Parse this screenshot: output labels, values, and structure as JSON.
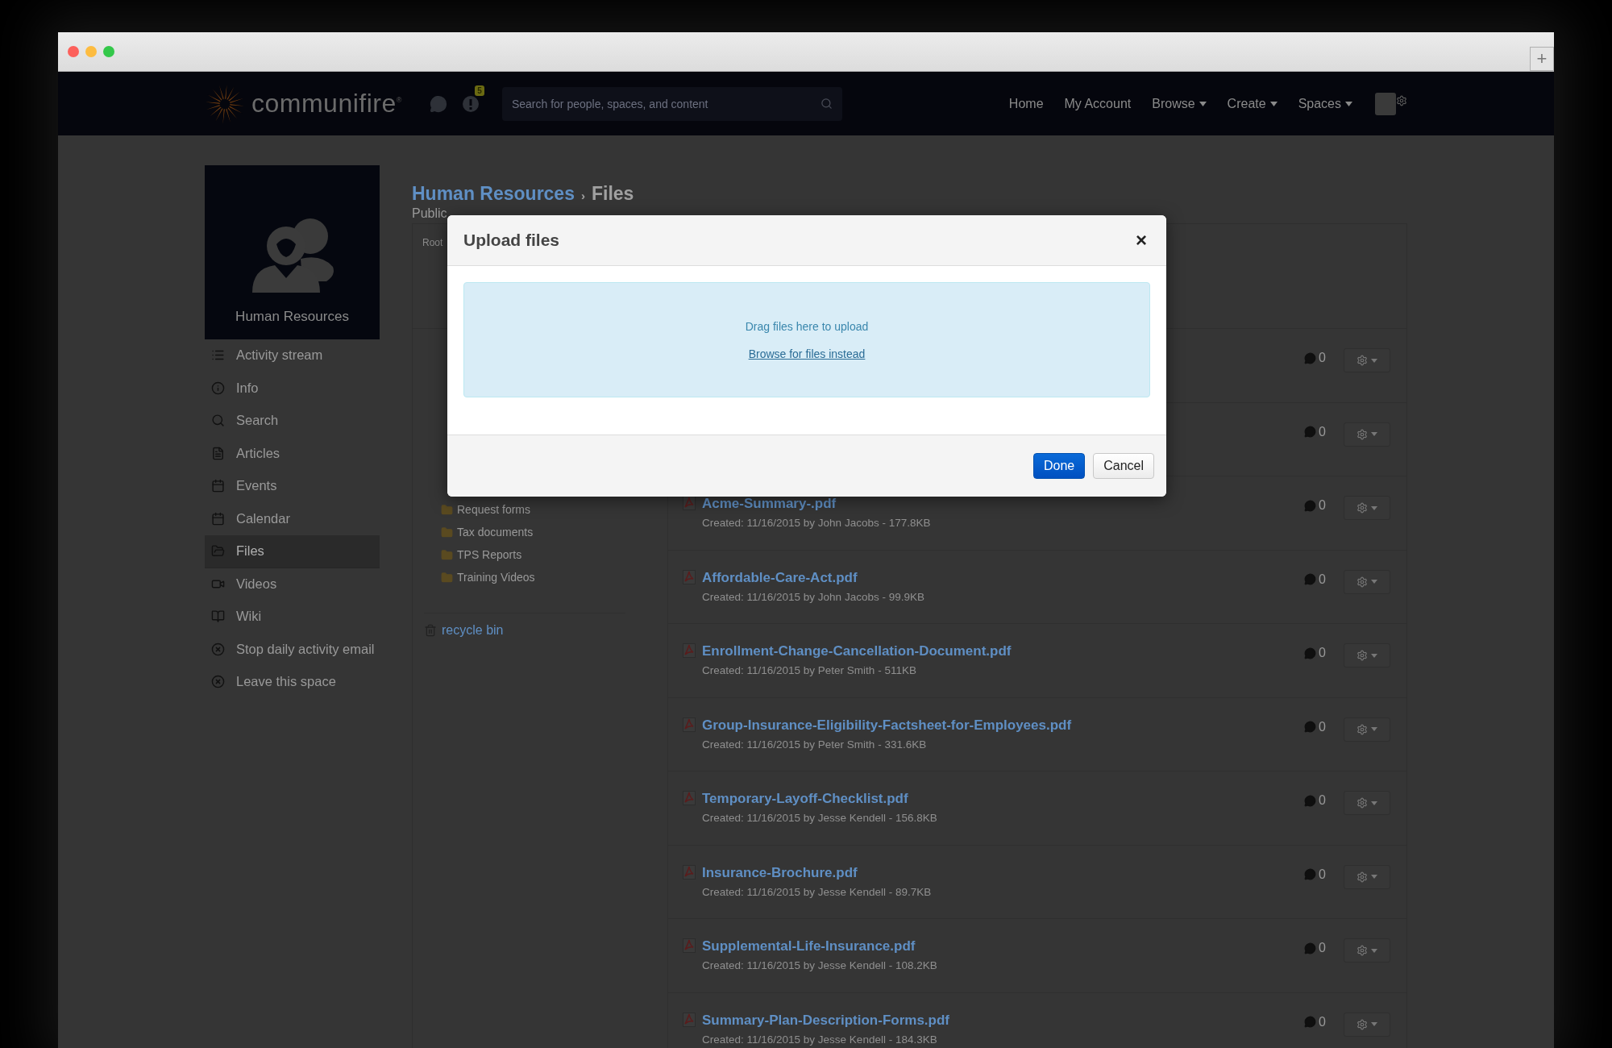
{
  "window": {
    "traffic_lights": [
      {
        "color": "#fc605b"
      },
      {
        "color": "#fdbc40"
      },
      {
        "color": "#34c84a"
      }
    ],
    "new_tab": "+"
  },
  "navbar": {
    "logo": "communifire",
    "logo_mark": "®",
    "notification_count": "5",
    "search": {
      "placeholder": "Search for people, spaces, and content"
    },
    "links": [
      {
        "label": "Home",
        "dropdown": false
      },
      {
        "label": "My Account",
        "dropdown": false
      },
      {
        "label": "Browse",
        "dropdown": true
      },
      {
        "label": "Create",
        "dropdown": true
      },
      {
        "label": "Spaces",
        "dropdown": true
      }
    ]
  },
  "space": {
    "name": "Human Resources"
  },
  "sidebar": {
    "items": [
      {
        "label": "Activity stream",
        "selected": false
      },
      {
        "label": "Info",
        "selected": false
      },
      {
        "label": "Search",
        "selected": false
      },
      {
        "label": "Articles",
        "selected": false
      },
      {
        "label": "Events",
        "selected": false
      },
      {
        "label": "Calendar",
        "selected": false
      },
      {
        "label": "Files",
        "selected": true
      },
      {
        "label": "Videos",
        "selected": false
      },
      {
        "label": "Wiki",
        "selected": false
      },
      {
        "label": "Stop daily activity email",
        "selected": false
      },
      {
        "label": "Leave this space",
        "selected": false
      }
    ]
  },
  "breadcrumb": {
    "parent": "Human Resources",
    "separator": "›",
    "current": "Files"
  },
  "subtitle": "Public",
  "folders": {
    "root": "Root",
    "items": [
      "Request forms",
      "Tax documents",
      "TPS Reports",
      "Training Videos"
    ],
    "recycle_bin": "recycle bin"
  },
  "files": [
    {
      "comments": "0"
    },
    {
      "comments": "0"
    },
    {
      "name": "Acme-Summary-.pdf",
      "meta": "Created: 11/16/2015 by John Jacobs - 177.8KB",
      "comments": "0"
    },
    {
      "name": "Affordable-Care-Act.pdf",
      "meta": "Created: 11/16/2015 by John Jacobs - 99.9KB",
      "comments": "0"
    },
    {
      "name": "Enrollment-Change-Cancellation-Document.pdf",
      "meta": "Created: 11/16/2015 by Peter Smith - 511KB",
      "comments": "0"
    },
    {
      "name": "Group-Insurance-Eligibility-Factsheet-for-Employees.pdf",
      "meta": "Created: 11/16/2015 by Peter Smith - 331.6KB",
      "comments": "0"
    },
    {
      "name": "Temporary-Layoff-Checklist.pdf",
      "meta": "Created: 11/16/2015 by Jesse Kendell - 156.8KB",
      "comments": "0"
    },
    {
      "name": "Insurance-Brochure.pdf",
      "meta": "Created: 11/16/2015 by Jesse Kendell - 89.7KB",
      "comments": "0"
    },
    {
      "name": "Supplemental-Life-Insurance.pdf",
      "meta": "Created: 11/16/2015 by Jesse Kendell - 108.2KB",
      "comments": "0"
    },
    {
      "name": "Summary-Plan-Description-Forms.pdf",
      "meta": "Created: 11/16/2015 by Jesse Kendell - 184.3KB",
      "comments": "0"
    }
  ],
  "modal": {
    "title": "Upload files",
    "close": "×",
    "drop_text": "Drag files here to upload",
    "browse_link": "Browse for files instead",
    "buttons": [
      {
        "label": "Done",
        "primary": true
      },
      {
        "label": "Cancel",
        "primary": false
      }
    ]
  }
}
